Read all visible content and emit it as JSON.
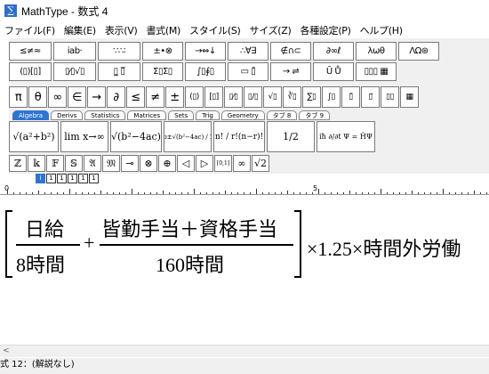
{
  "window": {
    "title": "MathType - 数式 4"
  },
  "menu": [
    "ファイル(F)",
    "編集(E)",
    "表示(V)",
    "書式(M)",
    "スタイル(S)",
    "サイズ(Z)",
    "各種設定(P)",
    "ヘルプ(H)"
  ],
  "palette_row1": [
    "≤≠≈",
    "i̇ab·",
    "∵∴∶",
    "±•⊗",
    "→⇔↓",
    "∴∀∃",
    "∉∩⊂",
    "∂∞ℓ",
    "λωθ",
    "ΛΩ⊛"
  ],
  "palette_row2": [
    "(▯)[▯]",
    "▯⁄▯√▯",
    "▯̲ ▯̅",
    "Σ▯Σ▯",
    "∫▯∮▯",
    "▭ ▯̄",
    "→ ⇌",
    "Ū Ů",
    "▯▯▯ ▦"
  ],
  "palette_row3": [
    "π",
    "θ",
    "∞",
    "∈",
    "→",
    "∂",
    "≤",
    "≠",
    "±",
    "(▯)",
    "[▯]",
    "▯⁄▯",
    "▯/▯",
    "√▯",
    "∛▯",
    "∑▯",
    "∫▯",
    "▯̄",
    "▯⃗",
    "▯▯",
    "▦"
  ],
  "tabs": [
    "Algebra",
    "Derivs",
    "Statistics",
    "Matrices",
    "Sets",
    "Trig",
    "Geometry",
    "タブ 8",
    "タブ 9"
  ],
  "active_tab": "Algebra",
  "templates": [
    "√(a²+b²)",
    "lim x→∞",
    "√(b²−4ac)",
    "−b±√(b²−4ac) / 2a",
    "n! / r!(n−r)!",
    "1/2",
    "iħ ∂/∂t Ψ = ĤΨ"
  ],
  "small_row": [
    "ℤ",
    "𝕜",
    "𝔽",
    "𝕊",
    "𝔄",
    "𝔐",
    "⊸",
    "⊗",
    "⊕",
    "◁",
    "▷",
    "[0,1]",
    "∞",
    "√2"
  ],
  "size_buttons": [
    "i",
    "1",
    "1",
    "1",
    "1",
    "1"
  ],
  "ruler_labels": [
    "0",
    "5"
  ],
  "equation": {
    "frac1_num": "日給",
    "frac1_den": "8時間",
    "plus": "+",
    "frac2_num": "皆勤手当＋資格手当",
    "frac2_den": "160時間",
    "tail": "×1.25×時間外労働"
  },
  "status": "式 12：(解説なし)"
}
